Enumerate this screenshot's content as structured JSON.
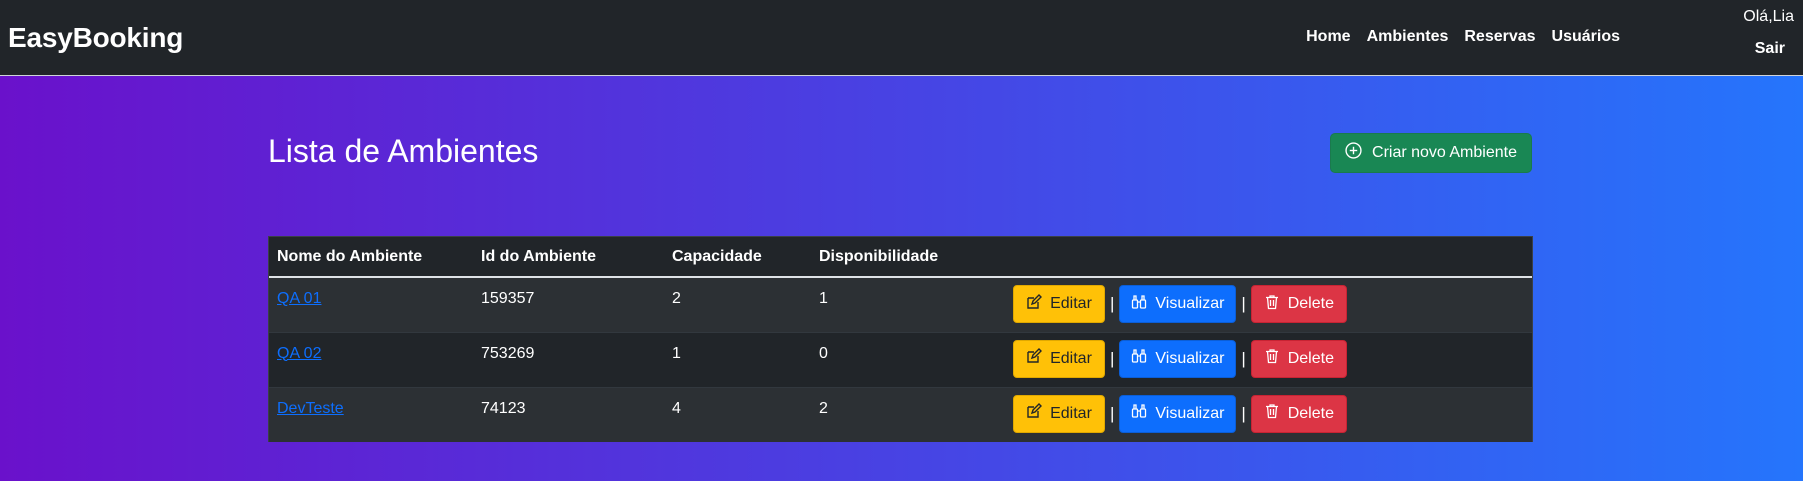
{
  "navbar": {
    "brand": "EasyBooking",
    "links": [
      "Home",
      "Ambientes",
      "Reservas",
      "Usuários"
    ],
    "greeting": "Olá,Lia",
    "logout": "Sair"
  },
  "page": {
    "title": "Lista de Ambientes",
    "create_button": "Criar novo Ambiente"
  },
  "table": {
    "headers": [
      "Nome do Ambiente",
      "Id do Ambiente",
      "Capacidade",
      "Disponibilidade",
      ""
    ],
    "rows": [
      {
        "name": "QA 01",
        "id": "159357",
        "capacity": "2",
        "availability": "1"
      },
      {
        "name": "QA 02",
        "id": "753269",
        "capacity": "1",
        "availability": "0"
      },
      {
        "name": "DevTeste",
        "id": "74123",
        "capacity": "4",
        "availability": "2"
      }
    ],
    "actions": {
      "edit": "Editar",
      "view": "Visualizar",
      "delete": "Delete",
      "separator": "|"
    }
  },
  "colors": {
    "navbar_bg": "#212529",
    "gradient_start": "#6a11cb",
    "gradient_end": "#2575fc",
    "success": "#198754",
    "warning": "#ffc107",
    "primary": "#0d6efd",
    "danger": "#dc3545"
  },
  "icons": {
    "create": "plus-circle-icon",
    "edit": "pencil-square-icon",
    "view": "binoculars-icon",
    "delete": "trash-icon"
  }
}
